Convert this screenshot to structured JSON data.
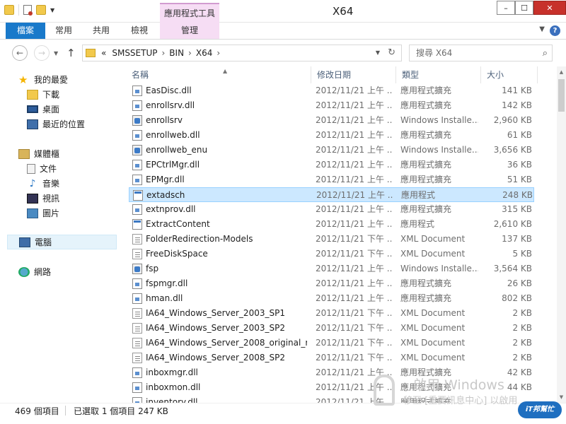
{
  "window": {
    "title": "X64"
  },
  "ribbon": {
    "contextual_group": "應用程式工具",
    "tabs": [
      {
        "label": "檔案",
        "active": true
      },
      {
        "label": "常用"
      },
      {
        "label": "共用"
      },
      {
        "label": "檢視"
      },
      {
        "label": "管理"
      }
    ],
    "help": "?"
  },
  "address": {
    "overflow": "«",
    "breadcrumbs": [
      "SMSSETUP",
      "BIN",
      "X64"
    ],
    "sep": "›"
  },
  "search": {
    "placeholder": "搜尋 X64"
  },
  "navpane": {
    "favorites": "我的最愛",
    "fav_items": [
      "下載",
      "桌面",
      "最近的位置"
    ],
    "libraries": "媒體櫃",
    "lib_items": [
      "文件",
      "音樂",
      "視訊",
      "圖片"
    ],
    "computer": "電腦",
    "network": "網路"
  },
  "columns": {
    "name": "名稱",
    "date": "修改日期",
    "type": "類型",
    "size": "大小"
  },
  "files": [
    {
      "name": "EasDisc.dll",
      "date": "2012/11/21 上午 ...",
      "type": "應用程式擴充",
      "size": "141 KB",
      "icon": "dll"
    },
    {
      "name": "enrollsrv.dll",
      "date": "2012/11/21 上午 ...",
      "type": "應用程式擴充",
      "size": "142 KB",
      "icon": "dll"
    },
    {
      "name": "enrollsrv",
      "date": "2012/11/21 上午 ...",
      "type": "Windows Installe...",
      "size": "2,960 KB",
      "icon": "msi"
    },
    {
      "name": "enrollweb.dll",
      "date": "2012/11/21 上午 ...",
      "type": "應用程式擴充",
      "size": "61 KB",
      "icon": "dll"
    },
    {
      "name": "enrollweb_enu",
      "date": "2012/11/21 上午 ...",
      "type": "Windows Installe...",
      "size": "3,656 KB",
      "icon": "msi"
    },
    {
      "name": "EPCtrlMgr.dll",
      "date": "2012/11/21 上午 ...",
      "type": "應用程式擴充",
      "size": "36 KB",
      "icon": "dll"
    },
    {
      "name": "EPMgr.dll",
      "date": "2012/11/21 上午 ...",
      "type": "應用程式擴充",
      "size": "51 KB",
      "icon": "dll"
    },
    {
      "name": "extadsch",
      "date": "2012/11/21 上午 ...",
      "type": "應用程式",
      "size": "248 KB",
      "icon": "exe",
      "selected": true
    },
    {
      "name": "extnprov.dll",
      "date": "2012/11/21 上午 ...",
      "type": "應用程式擴充",
      "size": "315 KB",
      "icon": "dll"
    },
    {
      "name": "ExtractContent",
      "date": "2012/11/21 上午 ...",
      "type": "應用程式",
      "size": "2,610 KB",
      "icon": "exe"
    },
    {
      "name": "FolderRedirection-Models",
      "date": "2012/11/21 下午 ...",
      "type": "XML Document",
      "size": "137 KB",
      "icon": "xml"
    },
    {
      "name": "FreeDiskSpace",
      "date": "2012/11/21 下午 ...",
      "type": "XML Document",
      "size": "5 KB",
      "icon": "xml"
    },
    {
      "name": "fsp",
      "date": "2012/11/21 上午 ...",
      "type": "Windows Installe...",
      "size": "3,564 KB",
      "icon": "msi"
    },
    {
      "name": "fspmgr.dll",
      "date": "2012/11/21 上午 ...",
      "type": "應用程式擴充",
      "size": "26 KB",
      "icon": "dll"
    },
    {
      "name": "hman.dll",
      "date": "2012/11/21 上午 ...",
      "type": "應用程式擴充",
      "size": "802 KB",
      "icon": "dll"
    },
    {
      "name": "IA64_Windows_Server_2003_SP1",
      "date": "2012/11/21 下午 ...",
      "type": "XML Document",
      "size": "2 KB",
      "icon": "xml"
    },
    {
      "name": "IA64_Windows_Server_2003_SP2",
      "date": "2012/11/21 下午 ...",
      "type": "XML Document",
      "size": "2 KB",
      "icon": "xml"
    },
    {
      "name": "IA64_Windows_Server_2008_original_r...",
      "date": "2012/11/21 下午 ...",
      "type": "XML Document",
      "size": "2 KB",
      "icon": "xml"
    },
    {
      "name": "IA64_Windows_Server_2008_SP2",
      "date": "2012/11/21 下午 ...",
      "type": "XML Document",
      "size": "2 KB",
      "icon": "xml"
    },
    {
      "name": "inboxmgr.dll",
      "date": "2012/11/21 上午 ...",
      "type": "應用程式擴充",
      "size": "42 KB",
      "icon": "dll"
    },
    {
      "name": "inboxmon.dll",
      "date": "2012/11/21 上午 ...",
      "type": "應用程式擴充",
      "size": "44 KB",
      "icon": "dll"
    },
    {
      "name": "inventory.dll",
      "date": "2012/11/21 上午 ...",
      "type": "應用程式擴充",
      "size": "...",
      "icon": "dll"
    }
  ],
  "status": {
    "item_count": "469 個項目",
    "selection": "已選取 1 個項目 247 KB"
  },
  "watermark": {
    "line1": "啟用 Windows",
    "line2": "移至 [重要訊息中心] 以啟用",
    "logo": "iT邦幫忙"
  },
  "colors": {
    "accent": "#1979ca",
    "selected_row": "#cce8ff",
    "manage_tab": "#f6ddf4"
  }
}
